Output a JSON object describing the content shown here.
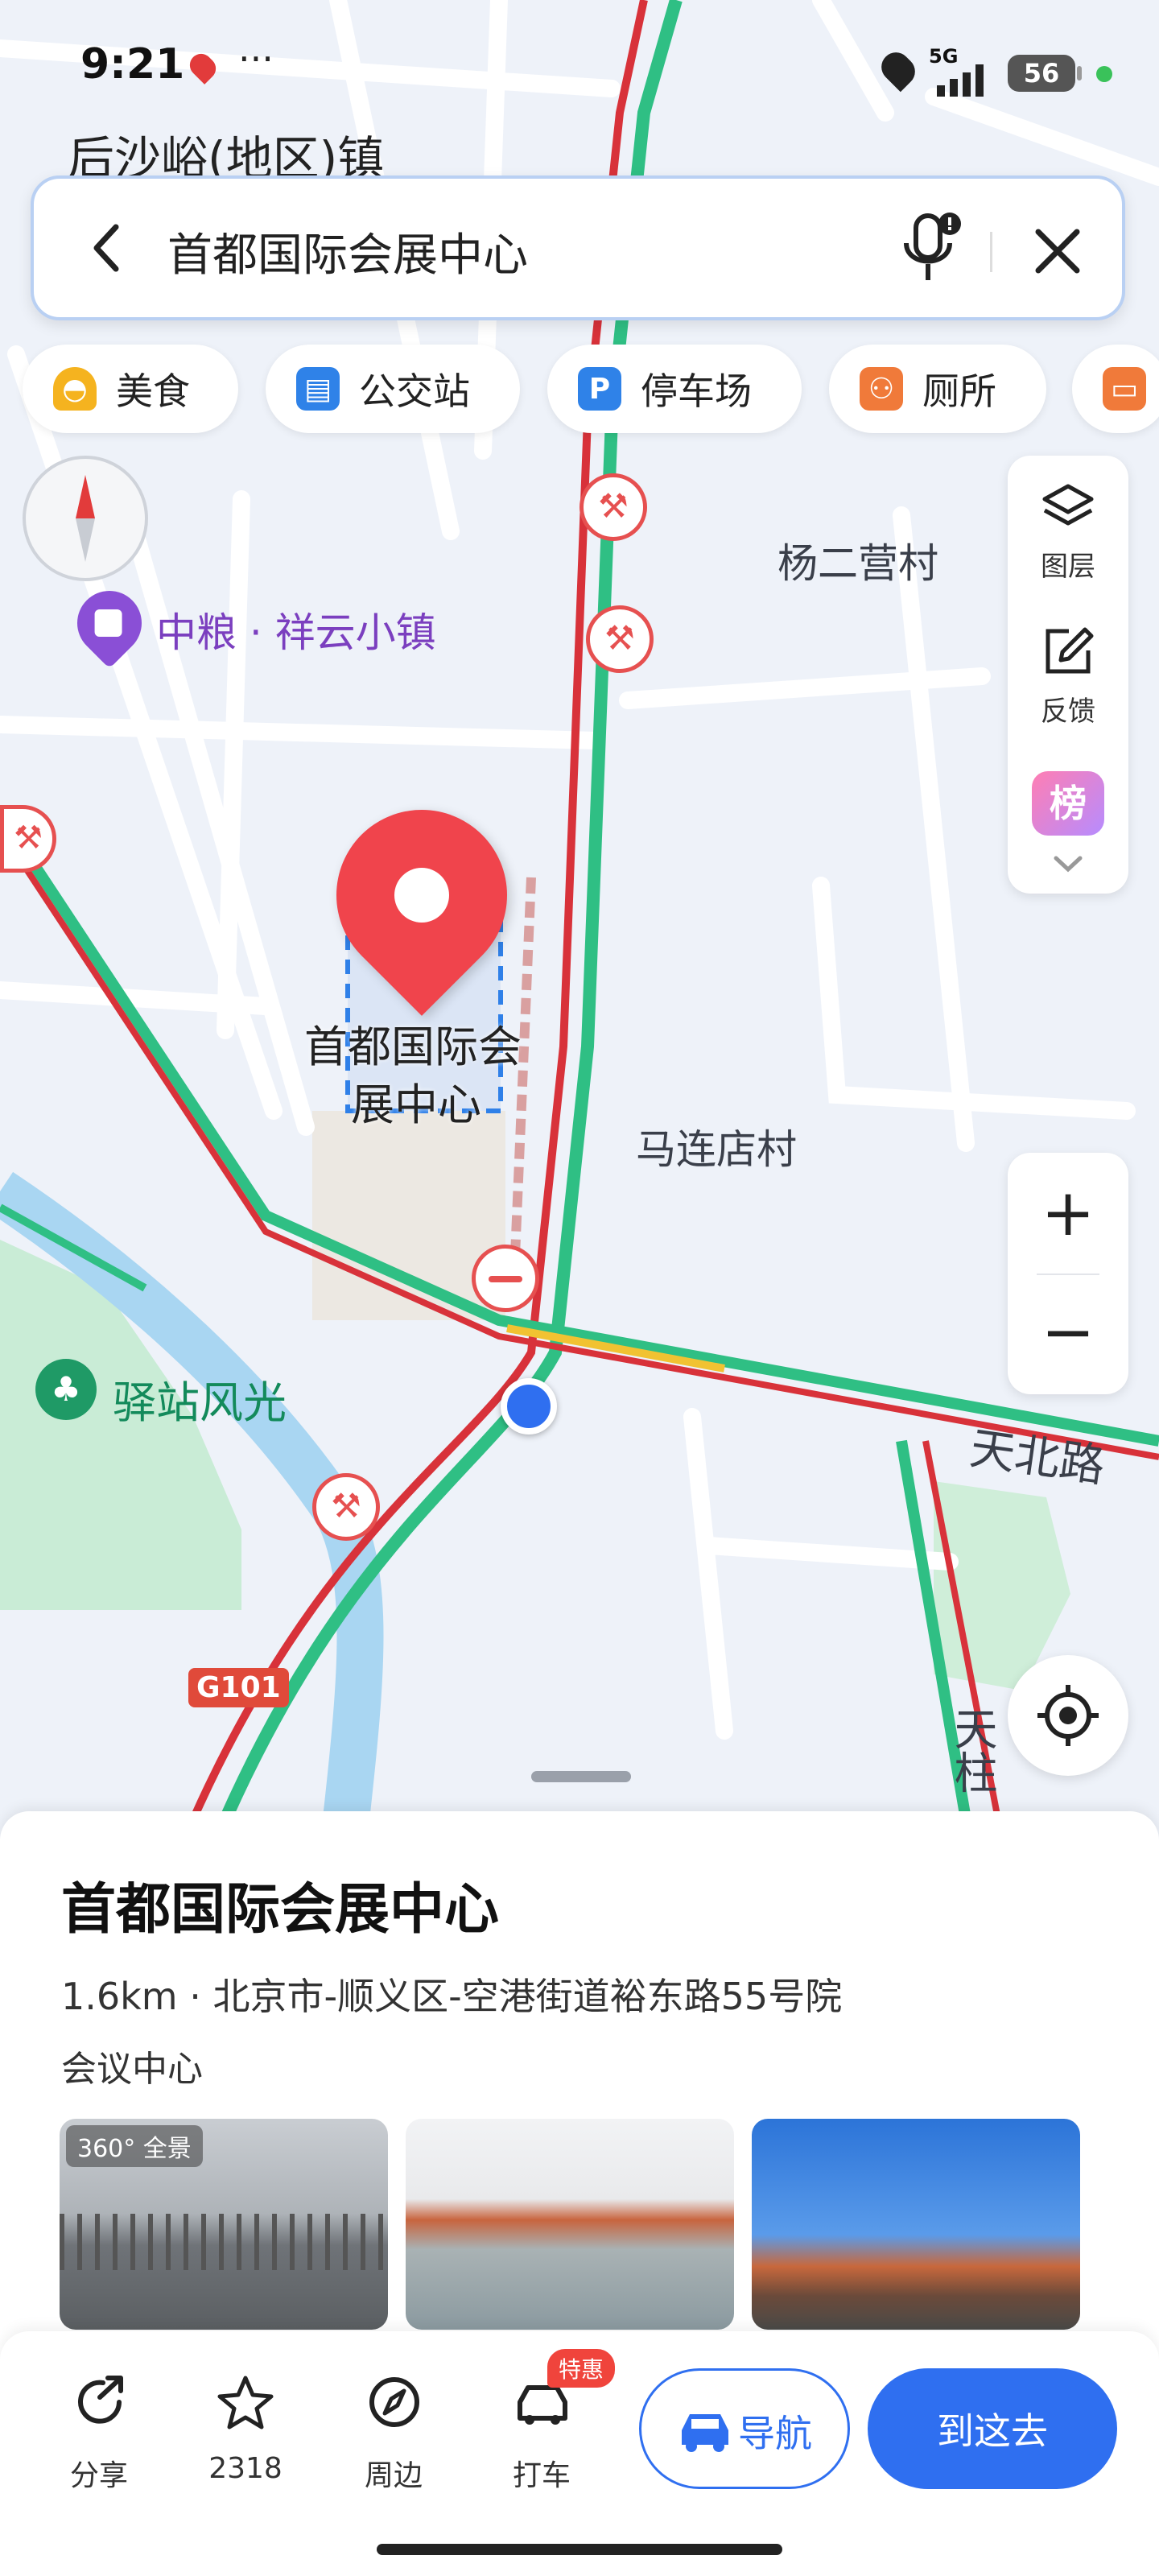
{
  "status_bar": {
    "time": "9:21",
    "more": "···",
    "network": "5G",
    "battery": "56"
  },
  "map": {
    "labels": {
      "town": "后沙峪(地区)镇",
      "zhongliang": "中粮 · 祥云小镇",
      "yang_village": "杨二营村",
      "marker_name_line1": "首都国际会",
      "marker_name_line2": "展中心",
      "malian_village": "马连店村",
      "yizhan": "驿站风光",
      "tianbei_road": "天北路",
      "tianzhu": "天柱",
      "highway": "G101"
    }
  },
  "search": {
    "value": "首都国际会展中心"
  },
  "chips": [
    {
      "label": "美食",
      "icon": "food-icon"
    },
    {
      "label": "公交站",
      "icon": "bus-stop-icon"
    },
    {
      "label": "停车场",
      "icon": "parking-icon"
    },
    {
      "label": "厕所",
      "icon": "toilet-icon"
    }
  ],
  "tools": {
    "layers": "图层",
    "feedback": "反馈",
    "ranking": "榜"
  },
  "zoom": {
    "plus": "+",
    "minus": "−"
  },
  "place": {
    "title": "首都国际会展中心",
    "address": "1.6km · 北京市-顺义区-空港街道裕东路55号院",
    "category": "会议中心",
    "pano_badge": "360° 全景"
  },
  "actions": {
    "share": "分享",
    "favorites_count": "2318",
    "nearby": "周边",
    "taxi": "打车",
    "taxi_badge": "特惠",
    "navigate": "导航",
    "go_here": "到这去"
  },
  "colors": {
    "accent": "#2f6ff0",
    "marker_red": "#f0444c",
    "traffic_green": "#2fbf84",
    "traffic_red": "#d8323a",
    "traffic_yellow": "#f1c232",
    "water": "#a9d6f2",
    "park": "#c9ecd6"
  }
}
